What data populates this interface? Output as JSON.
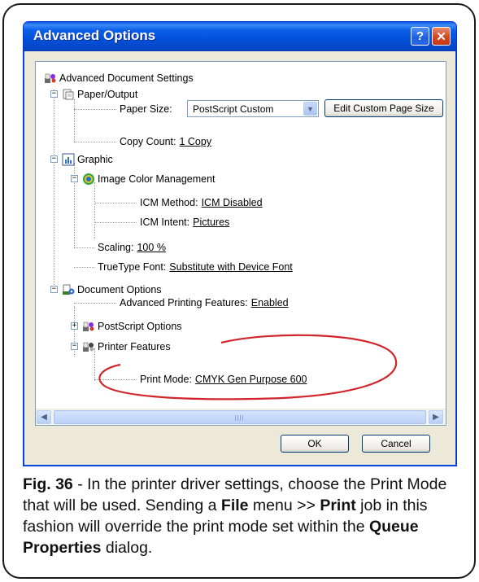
{
  "dialog": {
    "title": "Advanced Options",
    "help_icon": "help-icon",
    "close_icon": "close-icon"
  },
  "tree": {
    "root": "Advanced Document Settings",
    "paper_output": {
      "label": "Paper/Output",
      "paper_size_label": "Paper Size:",
      "paper_size_value": "PostScript Custom",
      "edit_custom_page_size": "Edit Custom Page Size",
      "copy_count_label": "Copy Count:",
      "copy_count_value": "1 Copy"
    },
    "graphic": {
      "label": "Graphic",
      "icm": "Image Color Management",
      "icm_method_label": "ICM Method:",
      "icm_method_value": "ICM Disabled",
      "icm_intent_label": "ICM Intent:",
      "icm_intent_value": "Pictures",
      "scaling_label": "Scaling:",
      "scaling_value": "100 %",
      "truetype_label": "TrueType Font:",
      "truetype_value": "Substitute with Device Font"
    },
    "document_options": {
      "label": "Document Options",
      "advanced_printing_label": "Advanced Printing Features:",
      "advanced_printing_value": "Enabled",
      "postscript_options": "PostScript Options",
      "printer_features": "Printer Features",
      "print_mode_label": "Print Mode:",
      "print_mode_value": "CMYK Gen Purpose 600"
    }
  },
  "buttons": {
    "ok": "OK",
    "cancel": "Cancel"
  },
  "caption": {
    "fig": "Fig. 36",
    "text_1": " - In the printer driver settings, choose the Print Mode that will be used. Sending a ",
    "file": "File",
    "text_2": " menu >> ",
    "print": "Print",
    "text_3": " job in this fashion will override the print mode set within the ",
    "queue_properties": "Queue Properties",
    "text_4": " dialog."
  },
  "colors": {
    "title_bar": "#0451d9",
    "dialog_bg": "#ece9d8",
    "annotation_red": "#d0262b"
  }
}
